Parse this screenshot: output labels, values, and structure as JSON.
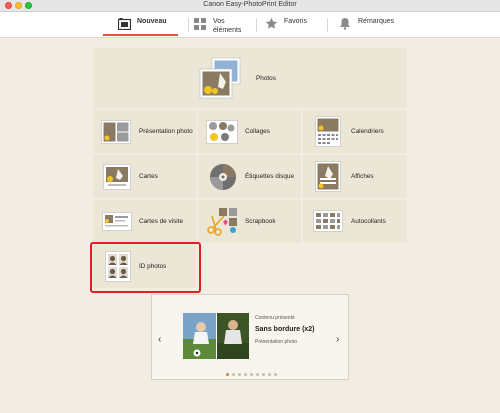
{
  "window": {
    "title": "Canon Easy-PhotoPrint Editor"
  },
  "nav": {
    "tabs": [
      {
        "label": "Nouveau",
        "icon": "new-doc-icon"
      },
      {
        "label": "Vos\néléments",
        "icon": "grid-icon"
      },
      {
        "label": "Favoris",
        "icon": "star-icon"
      },
      {
        "label": "Remarques",
        "icon": "bell-icon"
      }
    ],
    "active_color": "#d9573a"
  },
  "tiles": {
    "photos": "Photos",
    "presentation": "Présentation photo",
    "collages": "Collages",
    "calendriers": "Calendriers",
    "cartes": "Cartes",
    "etiquettes": "Étiquettes disque",
    "affiches": "Affiches",
    "cartes_visite": "Cartes de visite",
    "scrapbook": "Scrapbook",
    "autocollants": "Autocollants",
    "id_photos": "ID photos"
  },
  "carousel": {
    "small_label": "Contenu présenté",
    "title": "Sans bordure (x2)",
    "subtitle": "Présentation photo",
    "prev": "‹",
    "next": "›",
    "dot_count": 9,
    "active_dot": 1
  },
  "colors": {
    "background": "#f2ede3",
    "tile": "#ece6d6",
    "highlight": "#e02020"
  }
}
